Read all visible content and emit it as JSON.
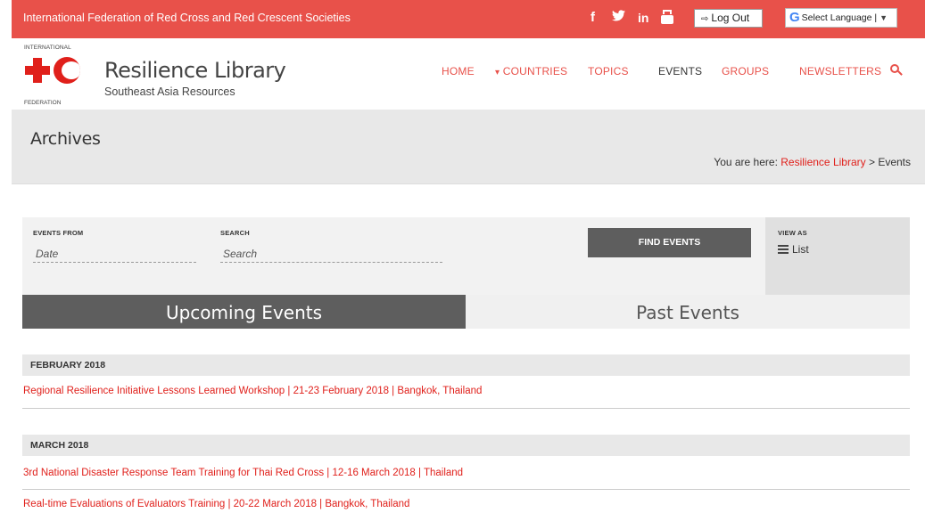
{
  "topbar": {
    "org_name": "International Federation of Red Cross and Red Crescent Societies",
    "social": [
      "facebook-icon",
      "twitter-icon",
      "linkedin-icon",
      "youtube-icon"
    ],
    "logout_label": "Log Out",
    "language_label": "Select Language",
    "language_arrow": "▼",
    "brand_color": "#e8514a"
  },
  "logo": {
    "top_text": "INTERNATIONAL",
    "bottom_text": "FEDERATION"
  },
  "site": {
    "title": "Resilience Library",
    "subtitle": "Southeast Asia Resources"
  },
  "nav": {
    "items": [
      {
        "label": "HOME",
        "active": false
      },
      {
        "label": "COUNTRIES",
        "active": false
      },
      {
        "label": "TOPICS",
        "active": false
      },
      {
        "label": "EVENTS",
        "active": true
      },
      {
        "label": "GROUPS",
        "active": false
      },
      {
        "label": "NEWSLETTERS",
        "active": false
      }
    ]
  },
  "archives": {
    "title": "Archives",
    "breadcrumb_prefix": "You are here: ",
    "breadcrumb_link": "Resilience Library",
    "breadcrumb_sep": " > ",
    "breadcrumb_current": "Events"
  },
  "filters": {
    "events_from_label": "EVENTS FROM",
    "events_from_placeholder": "Date",
    "search_label": "SEARCH",
    "search_placeholder": "Search",
    "find_button": "FIND EVENTS",
    "view_as_label": "VIEW AS",
    "view_as_value": "List"
  },
  "tabs": {
    "upcoming": "Upcoming Events",
    "past": "Past Events"
  },
  "events": {
    "groups": [
      {
        "month": "FEBRUARY 2018",
        "items": [
          "Regional Resilience Initiative Lessons Learned Workshop | 21-23 February 2018 | Bangkok, Thailand"
        ]
      },
      {
        "month": "MARCH 2018",
        "items": [
          "3rd National Disaster Response Team Training for Thai Red Cross | 12-16 March 2018 | Thailand",
          "Real-time Evaluations of Evaluators Training | 20-22 March 2018 | Bangkok, Thailand"
        ]
      }
    ]
  }
}
